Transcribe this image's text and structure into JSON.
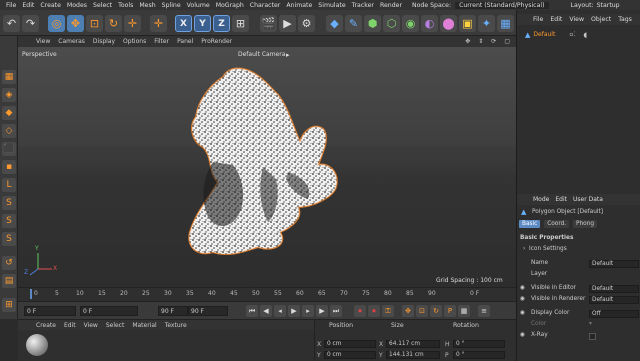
{
  "menubar": {
    "items": [
      "File",
      "Edit",
      "Create",
      "Modes",
      "Select",
      "Tools",
      "Mesh",
      "Spline",
      "Volume",
      "MoGraph",
      "Character",
      "Animate",
      "Simulate",
      "Tracker",
      "Render"
    ],
    "node_space_label": "Node Space:",
    "node_space_value": "Current (Standard/Physical)",
    "layout_label": "Layout:",
    "layout_value": "Startup"
  },
  "toolbar": {
    "x_label": "X",
    "y_label": "Y",
    "z_label": "Z"
  },
  "viewport_menu": {
    "items": [
      "View",
      "Cameras",
      "Display",
      "Options",
      "Filter",
      "Panel",
      "ProRender"
    ]
  },
  "viewport": {
    "projection_label": "Perspective",
    "camera_label": "Default Camera",
    "grid_spacing": "Grid Spacing : 100 cm",
    "axis_y": "Y",
    "axis_x": "X",
    "axis_z": "Z"
  },
  "timeline": {
    "ticks": [
      "0",
      "5",
      "10",
      "15",
      "20",
      "25",
      "30",
      "35",
      "40",
      "45",
      "50",
      "55",
      "60",
      "65",
      "70",
      "75",
      "80",
      "85",
      "90"
    ],
    "frame_end_label": "0 F"
  },
  "transport": {
    "current_frame": "0 F",
    "start_frame": "0 F",
    "end_frame": "90 F",
    "max_frame": "90 F"
  },
  "material_panel": {
    "menu": [
      "Create",
      "Edit",
      "View",
      "Select",
      "Material",
      "Texture"
    ]
  },
  "coordinates": {
    "headers": [
      "Position",
      "Size",
      "Rotation"
    ],
    "rows": [
      {
        "axis": "X",
        "pos": "0 cm",
        "size_axis": "X",
        "size": "64.117 cm",
        "rot_axis": "H",
        "rot": "0 °"
      },
      {
        "axis": "Y",
        "pos": "0 cm",
        "size_axis": "Y",
        "size": "144.131 cm",
        "rot_axis": "P",
        "rot": "0 °"
      }
    ]
  },
  "object_manager": {
    "menu": [
      "File",
      "Edit",
      "View",
      "Object",
      "Tags"
    ],
    "object_name": "Default"
  },
  "attributes": {
    "menu": [
      "Mode",
      "Edit",
      "User Data"
    ],
    "object_title": "Polygon Object [Default]",
    "tabs": [
      "Basic",
      "Coord.",
      "Phong"
    ],
    "section_title": "Basic Properties",
    "subsection": "Icon Settings",
    "props": [
      {
        "label": "Name",
        "value": "Default"
      },
      {
        "label": "Layer",
        "value": ""
      },
      {
        "label": "Visible in Editor",
        "value": "Default"
      },
      {
        "label": "Visible in Renderer",
        "value": "Default"
      },
      {
        "label": "Display Color",
        "value": "Off"
      },
      {
        "label": "Color",
        "value": ""
      },
      {
        "label": "X-Ray",
        "value": ""
      }
    ]
  },
  "colors": {
    "accent": "#5d8ac4",
    "highlight": "#ff9a2e",
    "selection_outline": "#d9792a"
  }
}
